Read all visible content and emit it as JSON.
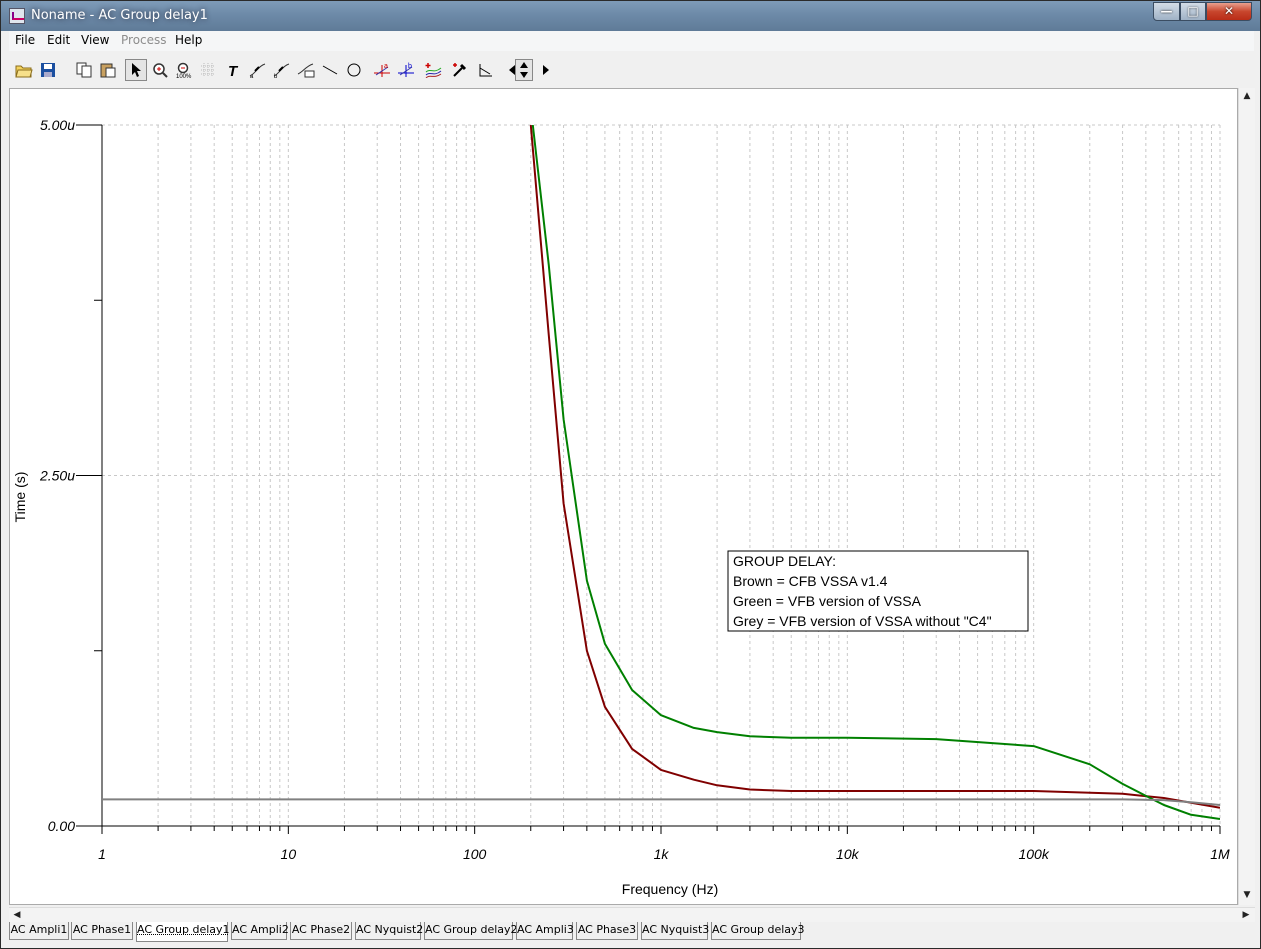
{
  "window": {
    "title": "Noname - AC Group delay1"
  },
  "menu": [
    {
      "label": "File",
      "enabled": true
    },
    {
      "label": "Edit",
      "enabled": true
    },
    {
      "label": "View",
      "enabled": true
    },
    {
      "label": "Process",
      "enabled": false
    },
    {
      "label": "Help",
      "enabled": true
    }
  ],
  "toolbar": [
    "open-icon",
    "save-icon",
    "copy-icon",
    "paste-icon",
    "pointer-icon",
    "zoom-in-icon",
    "zoom-100-icon",
    "grid-icon",
    "text-icon",
    "cursor-a-icon",
    "cursor-b-icon",
    "label-icon",
    "line-icon",
    "circle-icon",
    "marker-a-icon",
    "marker-b-icon",
    "add-curve-icon",
    "pick-color-icon",
    "axis-icon",
    "step-left-icon",
    "step-vertical-icon",
    "step-right-icon"
  ],
  "chart_data": {
    "type": "line",
    "xlabel": "Frequency (Hz)",
    "ylabel": "Time (s)",
    "x_scale": "log",
    "xlim": [
      1,
      1000000
    ],
    "ylim": [
      0,
      5e-06
    ],
    "x_ticks": [
      "1",
      "10",
      "100",
      "1k",
      "10k",
      "100k",
      "1M"
    ],
    "y_ticks": [
      "5.00u",
      "2.50u",
      "0.00"
    ],
    "grid": true,
    "legend_box": {
      "lines": [
        "GROUP DELAY:",
        "Brown = CFB VSSA v1.4",
        "Green = VFB version of VSSA",
        "Grey = VFB version of VSSA without \"C4\""
      ]
    },
    "series": [
      {
        "color": "#800000",
        "x": [
          200,
          250,
          300,
          400,
          500,
          700,
          1000,
          1500,
          2000,
          3000,
          5000,
          10000,
          30000,
          100000,
          300000,
          500000,
          1000000
        ],
        "y": [
          5e-06,
          3.5e-06,
          2.3e-06,
          1.25e-06,
          8.5e-07,
          5.5e-07,
          4e-07,
          3.3e-07,
          2.9e-07,
          2.6e-07,
          2.5e-07,
          2.5e-07,
          2.5e-07,
          2.5e-07,
          2.3e-07,
          2e-07,
          1.3e-07
        ]
      },
      {
        "color": "#008000",
        "x": [
          205,
          250,
          300,
          400,
          500,
          700,
          1000,
          1500,
          2000,
          3000,
          5000,
          10000,
          30000,
          100000,
          200000,
          300000,
          500000,
          700000,
          1000000
        ],
        "y": [
          5e-06,
          4e-06,
          2.9e-06,
          1.75e-06,
          1.3e-06,
          9.7e-07,
          7.9e-07,
          7e-07,
          6.7e-07,
          6.4e-07,
          6.3e-07,
          6.3e-07,
          6.2e-07,
          5.7e-07,
          4.4e-07,
          3e-07,
          1.5e-07,
          8e-08,
          5e-08
        ]
      },
      {
        "color": "#808080",
        "x": [
          1,
          10,
          100,
          1000,
          10000,
          100000,
          300000,
          500000,
          700000,
          1000000
        ],
        "y": [
          1.9e-07,
          1.9e-07,
          1.9e-07,
          1.9e-07,
          1.9e-07,
          1.9e-07,
          1.9e-07,
          1.85e-07,
          1.7e-07,
          1.5e-07
        ]
      }
    ]
  },
  "tabs": [
    {
      "label": "AC Ampli1",
      "active": false
    },
    {
      "label": "AC Phase1",
      "active": false
    },
    {
      "label": "AC Group delay1",
      "active": true
    },
    {
      "label": "AC Ampli2",
      "active": false
    },
    {
      "label": "AC Phase2",
      "active": false
    },
    {
      "label": "AC Nyquist2",
      "active": false
    },
    {
      "label": "AC Group delay2",
      "active": false
    },
    {
      "label": "AC Ampli3",
      "active": false
    },
    {
      "label": "AC Phase3",
      "active": false
    },
    {
      "label": "AC Nyquist3",
      "active": false
    },
    {
      "label": "AC Group delay3",
      "active": false
    }
  ]
}
